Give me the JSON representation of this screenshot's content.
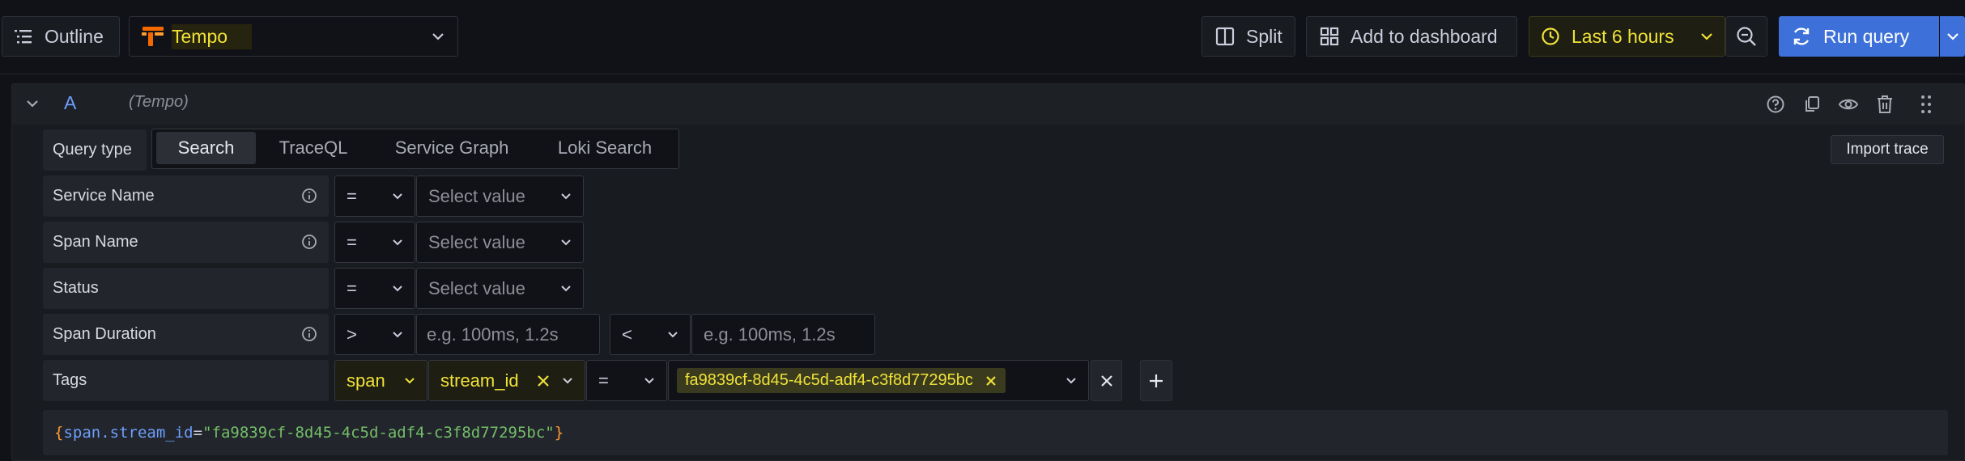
{
  "toolbar": {
    "outline_label": "Outline",
    "datasource_name": "Tempo",
    "split_label": "Split",
    "add_dashboard_label": "Add to dashboard",
    "time_range_label": "Last 6 hours",
    "run_query_label": "Run query"
  },
  "query": {
    "ref_id": "A",
    "datasource_tag": "(Tempo)",
    "import_trace_label": "Import trace",
    "query_type_label": "Query type",
    "tabs": [
      {
        "label": "Search",
        "active": true
      },
      {
        "label": "TraceQL",
        "active": false
      },
      {
        "label": "Service Graph",
        "active": false
      },
      {
        "label": "Loki Search",
        "active": false
      }
    ],
    "rows": {
      "service_name": {
        "label": "Service Name",
        "operator": "=",
        "value_placeholder": "Select value"
      },
      "span_name": {
        "label": "Span Name",
        "operator": "=",
        "value_placeholder": "Select value"
      },
      "status": {
        "label": "Status",
        "operator": "=",
        "value_placeholder": "Select value"
      },
      "span_duration": {
        "label": "Span Duration",
        "min_operator": ">",
        "min_placeholder": "e.g. 100ms, 1.2s",
        "max_operator": "<",
        "max_placeholder": "e.g. 100ms, 1.2s"
      },
      "tags": {
        "label": "Tags",
        "scope": "span",
        "tag_key": "stream_id",
        "operator": "=",
        "tag_value": "fa9839cf-8d45-4c5d-adf4-c3f8d77295bc"
      }
    },
    "preview": {
      "open_brace": "{",
      "key": "span.stream_id",
      "equals": "=",
      "value": "\"fa9839cf-8d45-4c5d-adf4-c3f8d77295bc\"",
      "close_brace": "}"
    }
  },
  "colors": {
    "background": "#111217",
    "primary_button": "#3d71d9",
    "time_accent": "#f0e238",
    "tempo_orange": "#f46800",
    "preview_blue": "#6e9fff",
    "preview_green": "#73bf69",
    "preview_orange": "#ff9830"
  }
}
